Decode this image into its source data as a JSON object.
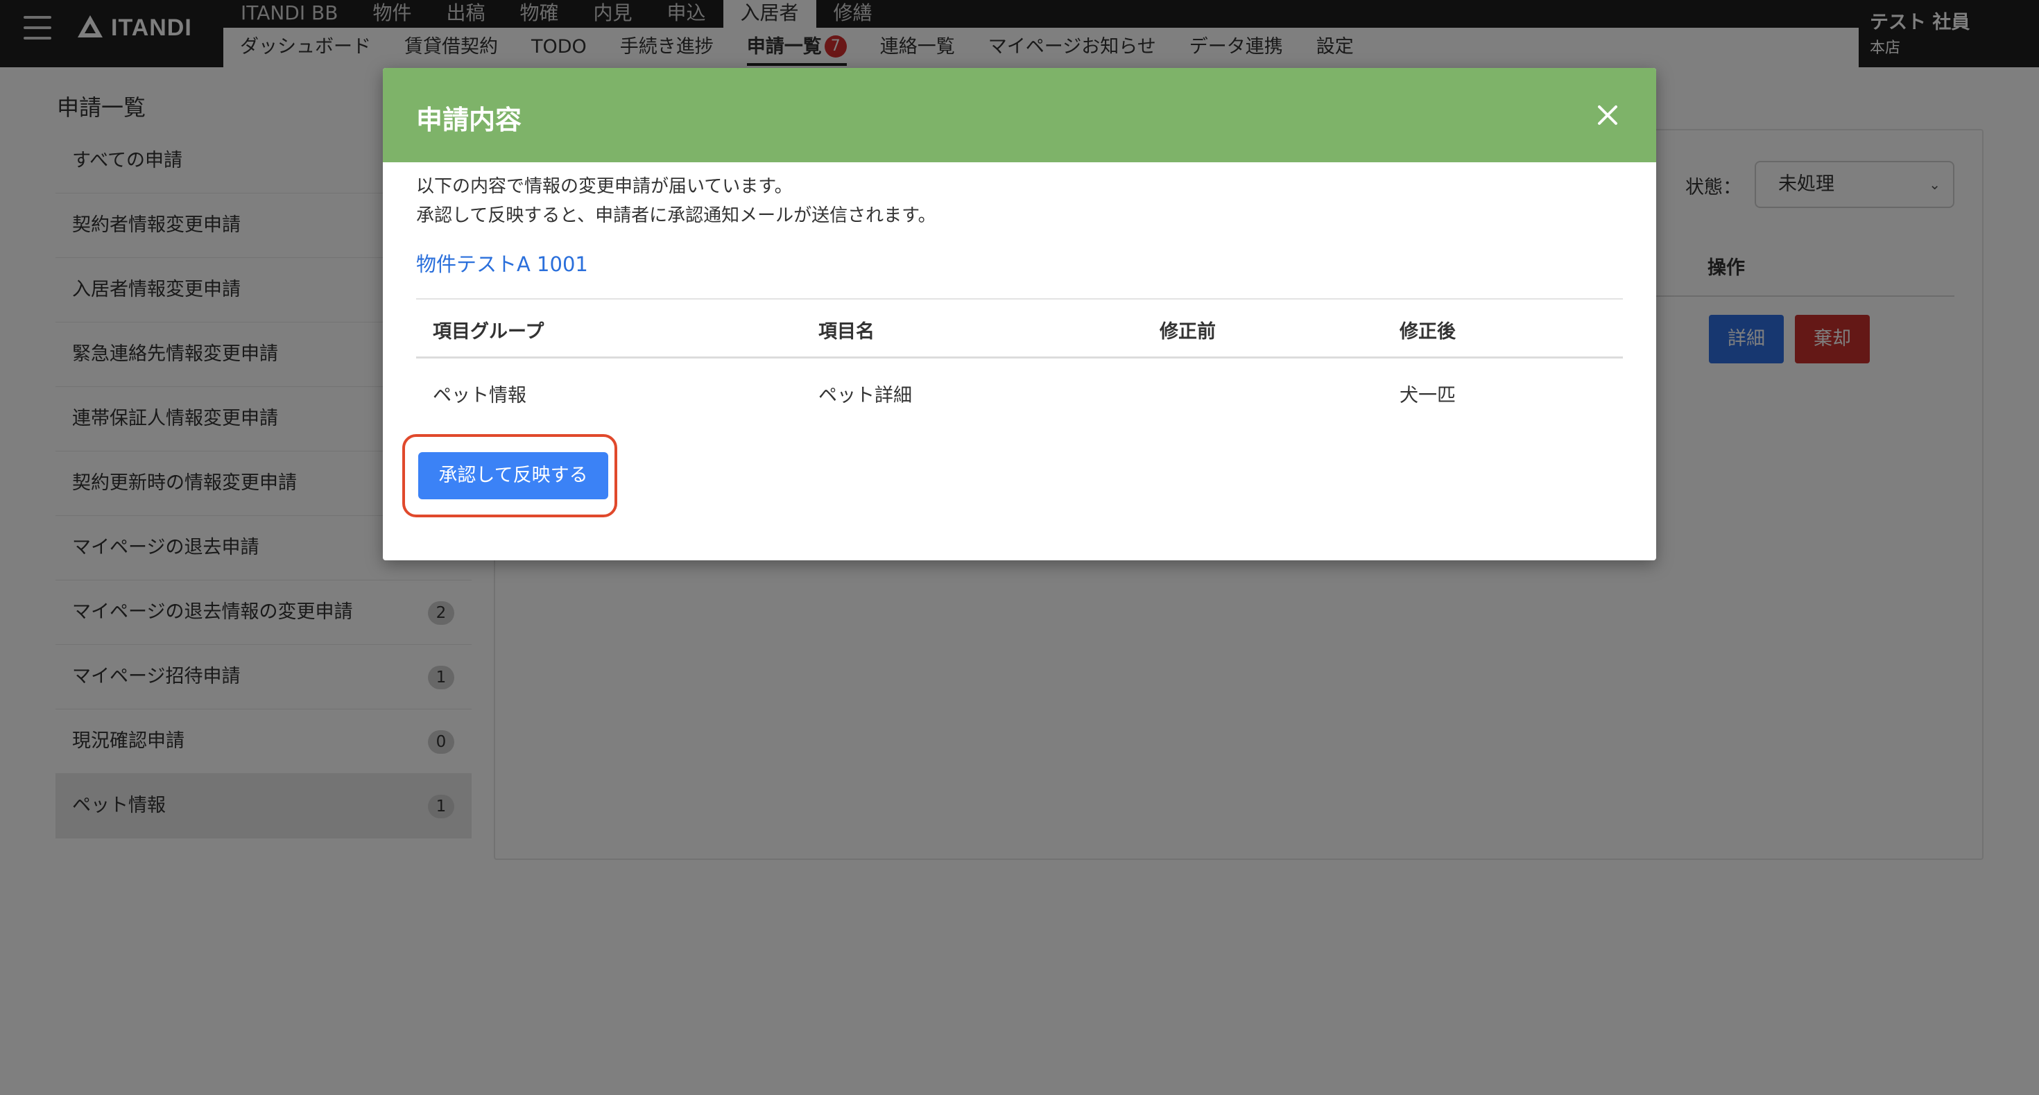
{
  "header": {
    "brand": "ITANDI",
    "top_nav": [
      "ITANDI BB",
      "物件",
      "出稿",
      "物確",
      "内見",
      "申込",
      "入居者",
      "修繕"
    ],
    "top_nav_active": "入居者",
    "sub_nav": [
      "ダッシュボード",
      "賃貸借契約",
      "TODO",
      "手続き進捗",
      "申請一覧",
      "連絡一覧",
      "マイページお知らせ",
      "データ連携",
      "設定"
    ],
    "sub_nav_active": "申請一覧",
    "sub_nav_badge": "7",
    "user_name": "テスト 社員",
    "user_store": "本店"
  },
  "page": {
    "title": "申請一覧",
    "sidebar": [
      {
        "label": "すべての申請",
        "count": ""
      },
      {
        "label": "契約者情報変更申請",
        "count": ""
      },
      {
        "label": "入居者情報変更申請",
        "count": ""
      },
      {
        "label": "緊急連絡先情報変更申請",
        "count": ""
      },
      {
        "label": "連帯保証人情報変更申請",
        "count": ""
      },
      {
        "label": "契約更新時の情報変更申請",
        "count": ""
      },
      {
        "label": "マイページの退去申請",
        "count": ""
      },
      {
        "label": "マイページの退去情報の変更申請",
        "count": "2"
      },
      {
        "label": "マイページ招待申請",
        "count": "1"
      },
      {
        "label": "現況確認申請",
        "count": "0"
      },
      {
        "label": "ペット情報",
        "count": "1"
      }
    ],
    "sidebar_active": "ペット情報",
    "filter": {
      "label": "状態：",
      "value": "未処理"
    },
    "table_op_header": "操作",
    "detail_button": "詳細",
    "reject_button": "棄却"
  },
  "modal": {
    "title": "申請内容",
    "message_line1": "以下の内容で情報の変更申請が届いています。",
    "message_line2": "承認して反映すると、申請者に承認通知メールが送信されます。",
    "property_link": "物件テストA 1001",
    "columns": [
      "項目グループ",
      "項目名",
      "修正前",
      "修正後"
    ],
    "rows": [
      [
        "ペット情報",
        "ペット詳細",
        "",
        "犬一匹"
      ]
    ],
    "approve_button": "承認して反映する"
  },
  "colors": {
    "modal_header": "#7eb369",
    "primary_button": "#3b82f6",
    "highlight_ring": "#e0492c",
    "detail_button": "#2f6fe0",
    "reject_button": "#c9302c",
    "nav_dark": "#1e1e1e",
    "badge": "#d42f2f"
  },
  "icons": {
    "menu": "hamburger-menu-icon",
    "logo": "itandi-logo-icon",
    "close": "close-icon",
    "select": "chevron-down-icon"
  }
}
